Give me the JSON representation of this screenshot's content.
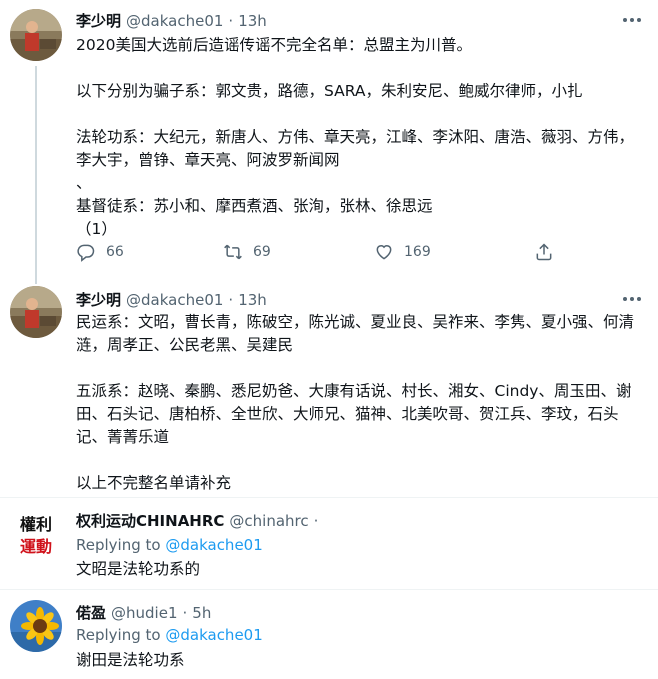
{
  "tweets": [
    {
      "name": "李少明",
      "handle": "@dakache01",
      "dot": "·",
      "time": "13h",
      "text": "2020美国大选前后造谣传谣不完全名单：总盟主为川普。\n\n以下分别为骗子系：郭文贵，路德，SARA，朱利安尼、鲍威尔律师，小扎\n\n法轮功系：大纪元，新唐人、方伟、章天亮，江峰、李沐阳、唐浩、薇羽、方伟，李大宇，曾铮、章天亮、阿波罗新闻网\n、\n基督徒系：苏小和、摩西煮酒、张洵，张林、徐思远\n（1）",
      "actions": {
        "replies": "66",
        "retweets": "69",
        "likes": "169"
      }
    },
    {
      "name": "李少明",
      "handle": "@dakache01",
      "dot": "·",
      "time": "13h",
      "text": "民运系：文昭，曹长青，陈破空，陈光诚、夏业良、吴祚来、李隽、夏小强、何清涟，周孝正、公民老黑、吴建民\n\n五派系：赵晓、秦鹏、悉尼奶爸、大康有话说、村长、湘女、Cindy、周玉田、谢田、石头记、唐柏桥、全世欣、大师兄、猫神、北美吹哥、贺江兵、李玟，石头记、菁菁乐道\n\n以上不完整名单请补充"
    },
    {
      "name": "权利运动CHINAHRC",
      "handle": "@chinahrc",
      "dot": "·",
      "replying_label": "Replying to",
      "replying_handle": "@dakache01",
      "text": "文昭是法轮功系的",
      "avatar_text": [
        "權利",
        "運動"
      ]
    },
    {
      "name": "偌盈",
      "handle": "@hudie1",
      "dot": "·",
      "time": "5h",
      "replying_label": "Replying to",
      "replying_handle": "@dakache01",
      "text": "谢田是法轮功系"
    }
  ],
  "colors": {
    "text": "#0f1419",
    "secondary": "#536471",
    "link": "#1d9bf0",
    "divider": "#eff3f4",
    "thread_line": "#cfd9de"
  },
  "icons": [
    "reply-icon",
    "retweet-icon",
    "like-icon",
    "share-icon",
    "more-icon"
  ]
}
